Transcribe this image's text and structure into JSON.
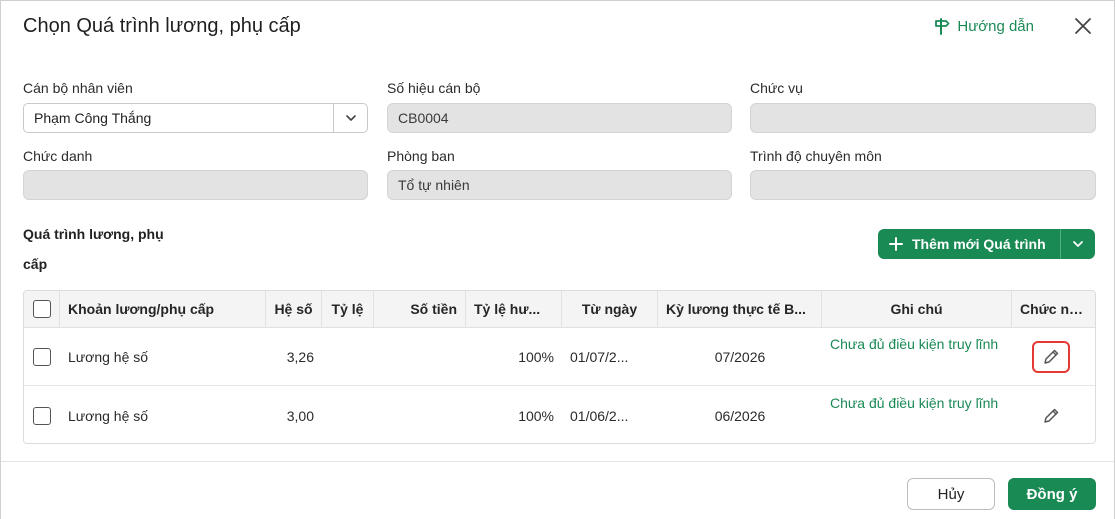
{
  "dialog": {
    "title": "Chọn Quá trình lương, phụ cấp",
    "guide_label": "Hướng dẫn",
    "accent_color": "#1a8a55"
  },
  "form": {
    "employee": {
      "label": "Cán bộ nhân viên",
      "value": "Phạm Công Thắng"
    },
    "employee_code": {
      "label": "Số hiệu cán bộ",
      "value": "CB0004"
    },
    "position": {
      "label": "Chức vụ",
      "value": ""
    },
    "title": {
      "label": "Chức danh",
      "value": ""
    },
    "department": {
      "label": "Phòng ban",
      "value": "Tổ tự nhiên"
    },
    "qualification": {
      "label": "Trình độ chuyên môn",
      "value": ""
    }
  },
  "section": {
    "title": "Quá trình lương, phụ cấp",
    "add_button_label": "Thêm mới Quá trình"
  },
  "table": {
    "columns": [
      "Khoản lương/phụ cấp",
      "Hệ số",
      "Tỷ lệ",
      "Số tiền",
      "Tỷ lệ hư...",
      "Từ ngày",
      "Kỳ lương thực tế B...",
      "Ghi chú",
      "Chức năng"
    ],
    "rows": [
      {
        "khoan": "Lương hệ số",
        "he_so": "3,26",
        "ty_le": "",
        "so_tien": "",
        "ty_le_huong": "100%",
        "tu_ngay": "01/07/2...",
        "ky_luong": "07/2026",
        "ghi_chu": "Chưa đủ điều kiện truy lĩnh"
      },
      {
        "khoan": "Lương hệ số",
        "he_so": "3,00",
        "ty_le": "",
        "so_tien": "",
        "ty_le_huong": "100%",
        "tu_ngay": "01/06/2...",
        "ky_luong": "06/2026",
        "ghi_chu": "Chưa đủ điều kiện truy lĩnh"
      }
    ]
  },
  "footer": {
    "cancel_label": "Hủy",
    "ok_label": "Đồng ý"
  },
  "icons": {
    "guide": "signpost-icon",
    "close": "close-icon",
    "dropdown": "chevron-down-icon",
    "add": "plus-icon",
    "edit": "pencil-icon"
  }
}
